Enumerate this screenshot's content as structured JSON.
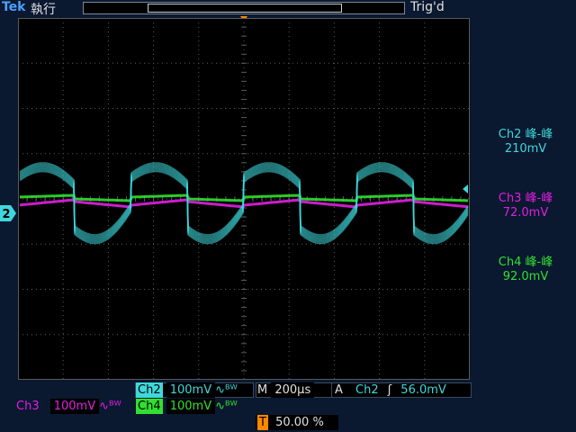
{
  "header": {
    "brand": "Tek",
    "run_status": "執行",
    "trigger_status": "Trig'd"
  },
  "colors": {
    "ch2": "#3ed8dc",
    "ch3": "#e020e0",
    "ch4": "#30e030",
    "trigger": "#ff8800",
    "grid": "#5a5a5a"
  },
  "measurements": [
    {
      "name": "Ch2 峰-峰",
      "value": "210mV",
      "color": "#3ed8dc"
    },
    {
      "name": "Ch3 峰-峰",
      "value": "72.0mV",
      "color": "#e020e0"
    },
    {
      "name": "Ch4 峰-峰",
      "value": "92.0mV",
      "color": "#30e030"
    }
  ],
  "markers": {
    "channel": "2",
    "trigger": "T"
  },
  "bottom": {
    "ch2_label": "Ch2",
    "ch2_scale": "100mV",
    "ch3_label": "Ch3",
    "ch3_scale": "100mV",
    "ch4_label": "Ch4",
    "ch4_scale": "100mV",
    "bw_symbol": "∿ᴮᵂ",
    "timebase_label": "M",
    "timebase_value": "200µs",
    "trigger_mode": "A",
    "trigger_source": "Ch2",
    "trigger_slope": "ʃ",
    "trigger_level": "56.0mV",
    "trigger_marker": "T",
    "trigger_position": "50.00 %"
  }
}
